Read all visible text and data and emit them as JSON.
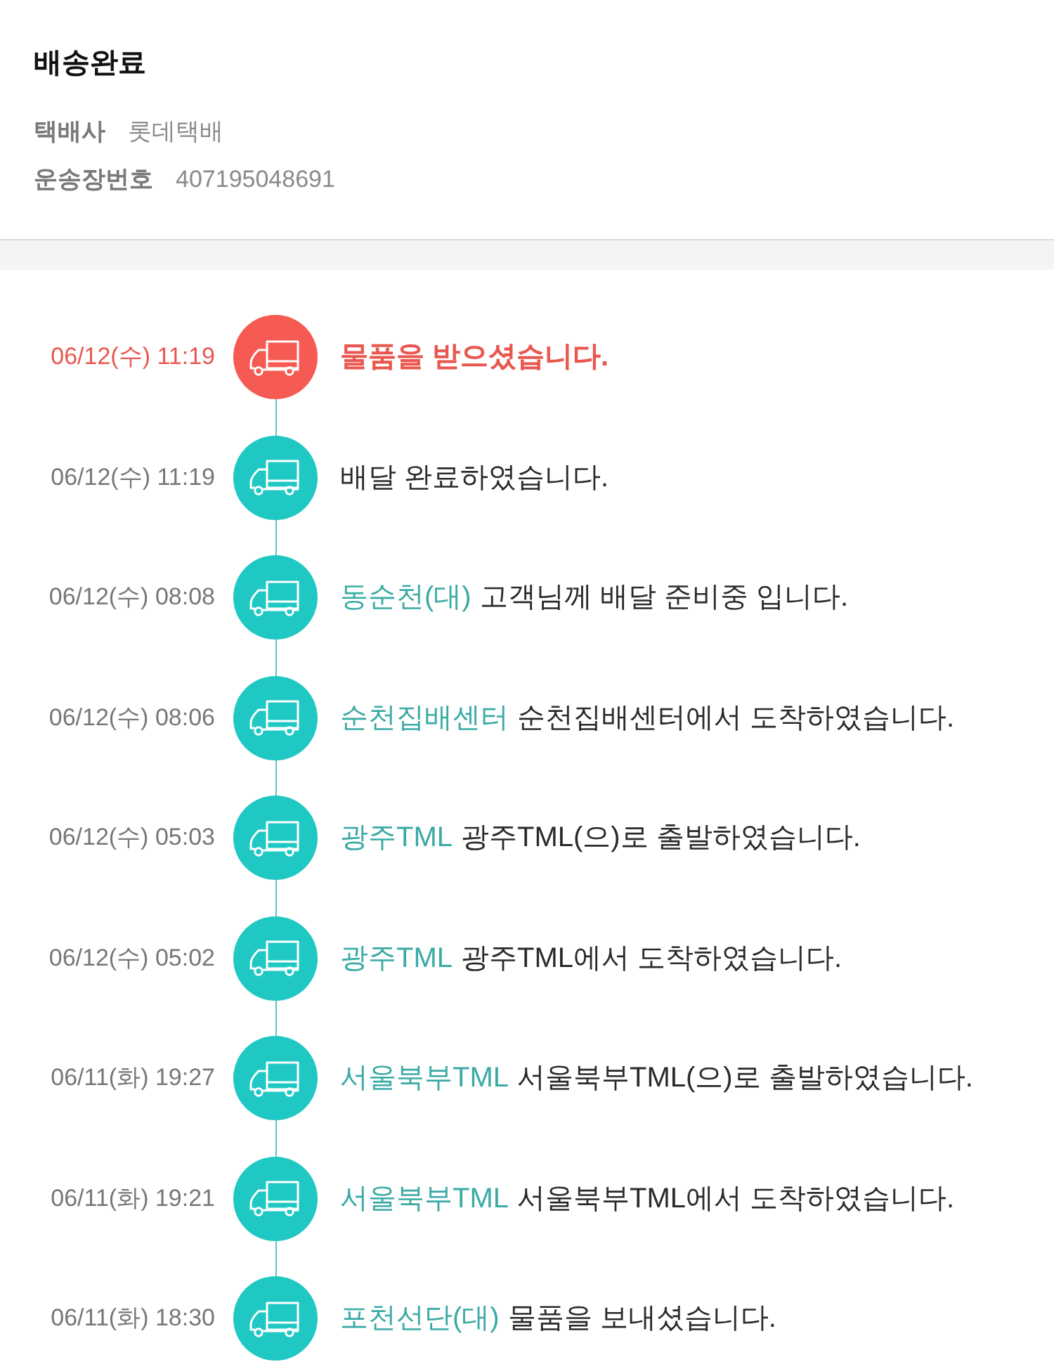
{
  "header": {
    "title": "배송완료",
    "fields": [
      {
        "label": "택배사",
        "value": "롯데택배"
      },
      {
        "label": "운송장번호",
        "value": "407195048691"
      }
    ]
  },
  "timeline": [
    {
      "time": "06/12(수) 11:19",
      "current": true,
      "message": "물품을 받으셨습니다."
    },
    {
      "time": "06/12(수) 11:19",
      "current": false,
      "message": "배달 완료하였습니다."
    },
    {
      "time": "06/12(수) 08:08",
      "current": false,
      "location": "동순천(대)",
      "message": "고객님께 배달 준비중 입니다."
    },
    {
      "time": "06/12(수) 08:06",
      "current": false,
      "location": "순천집배센터",
      "message": "순천집배센터에서 도착하였습니다."
    },
    {
      "time": "06/12(수) 05:03",
      "current": false,
      "location": "광주TML",
      "message": "광주TML(으)로 출발하였습니다."
    },
    {
      "time": "06/12(수) 05:02",
      "current": false,
      "location": "광주TML",
      "message": "광주TML에서 도착하였습니다."
    },
    {
      "time": "06/11(화) 19:27",
      "current": false,
      "location": "서울북부TML",
      "message": "서울북부TML(으)로 출발하였습니다."
    },
    {
      "time": "06/11(화) 19:21",
      "current": false,
      "location": "서울북부TML",
      "message": "서울북부TML에서 도착하였습니다."
    },
    {
      "time": "06/11(화) 18:30",
      "current": false,
      "location": "포천선단(대)",
      "message": "물품을 보내셨습니다."
    }
  ]
}
